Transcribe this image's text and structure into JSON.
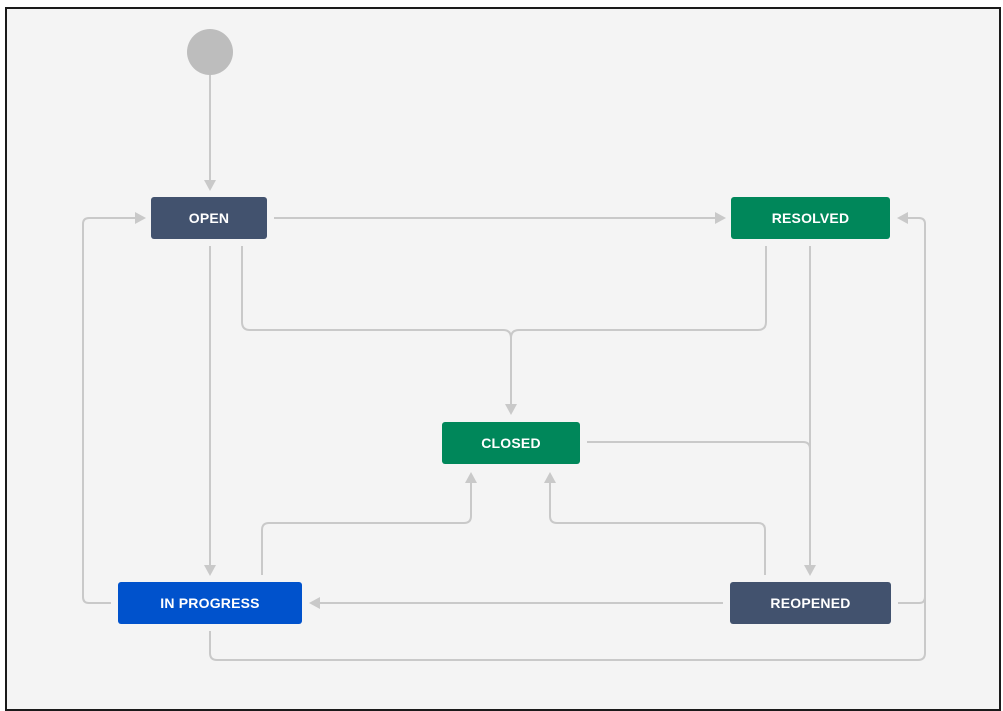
{
  "colors": {
    "background": "#f4f4f4",
    "edge": "#c9c9c9",
    "start_node": "#bdbdbd",
    "todo": "#42526e",
    "done": "#00875a",
    "in_progress": "#0052cc"
  },
  "workflow": {
    "statuses": {
      "open": {
        "label": "OPEN",
        "category": "todo"
      },
      "resolved": {
        "label": "RESOLVED",
        "category": "done"
      },
      "closed": {
        "label": "CLOSED",
        "category": "done"
      },
      "in_progress": {
        "label": "IN PROGRESS",
        "category": "in_progress"
      },
      "reopened": {
        "label": "REOPENED",
        "category": "todo"
      }
    },
    "transitions": [
      {
        "from": "start",
        "to": "open"
      },
      {
        "from": "open",
        "to": "resolved"
      },
      {
        "from": "open",
        "to": "closed"
      },
      {
        "from": "resolved",
        "to": "closed"
      },
      {
        "from": "open",
        "to": "in_progress"
      },
      {
        "from": "in_progress",
        "to": "open"
      },
      {
        "from": "in_progress",
        "to": "closed"
      },
      {
        "from": "in_progress",
        "to": "resolved"
      },
      {
        "from": "resolved",
        "to": "reopened"
      },
      {
        "from": "closed",
        "to": "reopened"
      },
      {
        "from": "reopened",
        "to": "closed"
      },
      {
        "from": "reopened",
        "to": "in_progress"
      },
      {
        "from": "reopened",
        "to": "resolved"
      }
    ]
  }
}
